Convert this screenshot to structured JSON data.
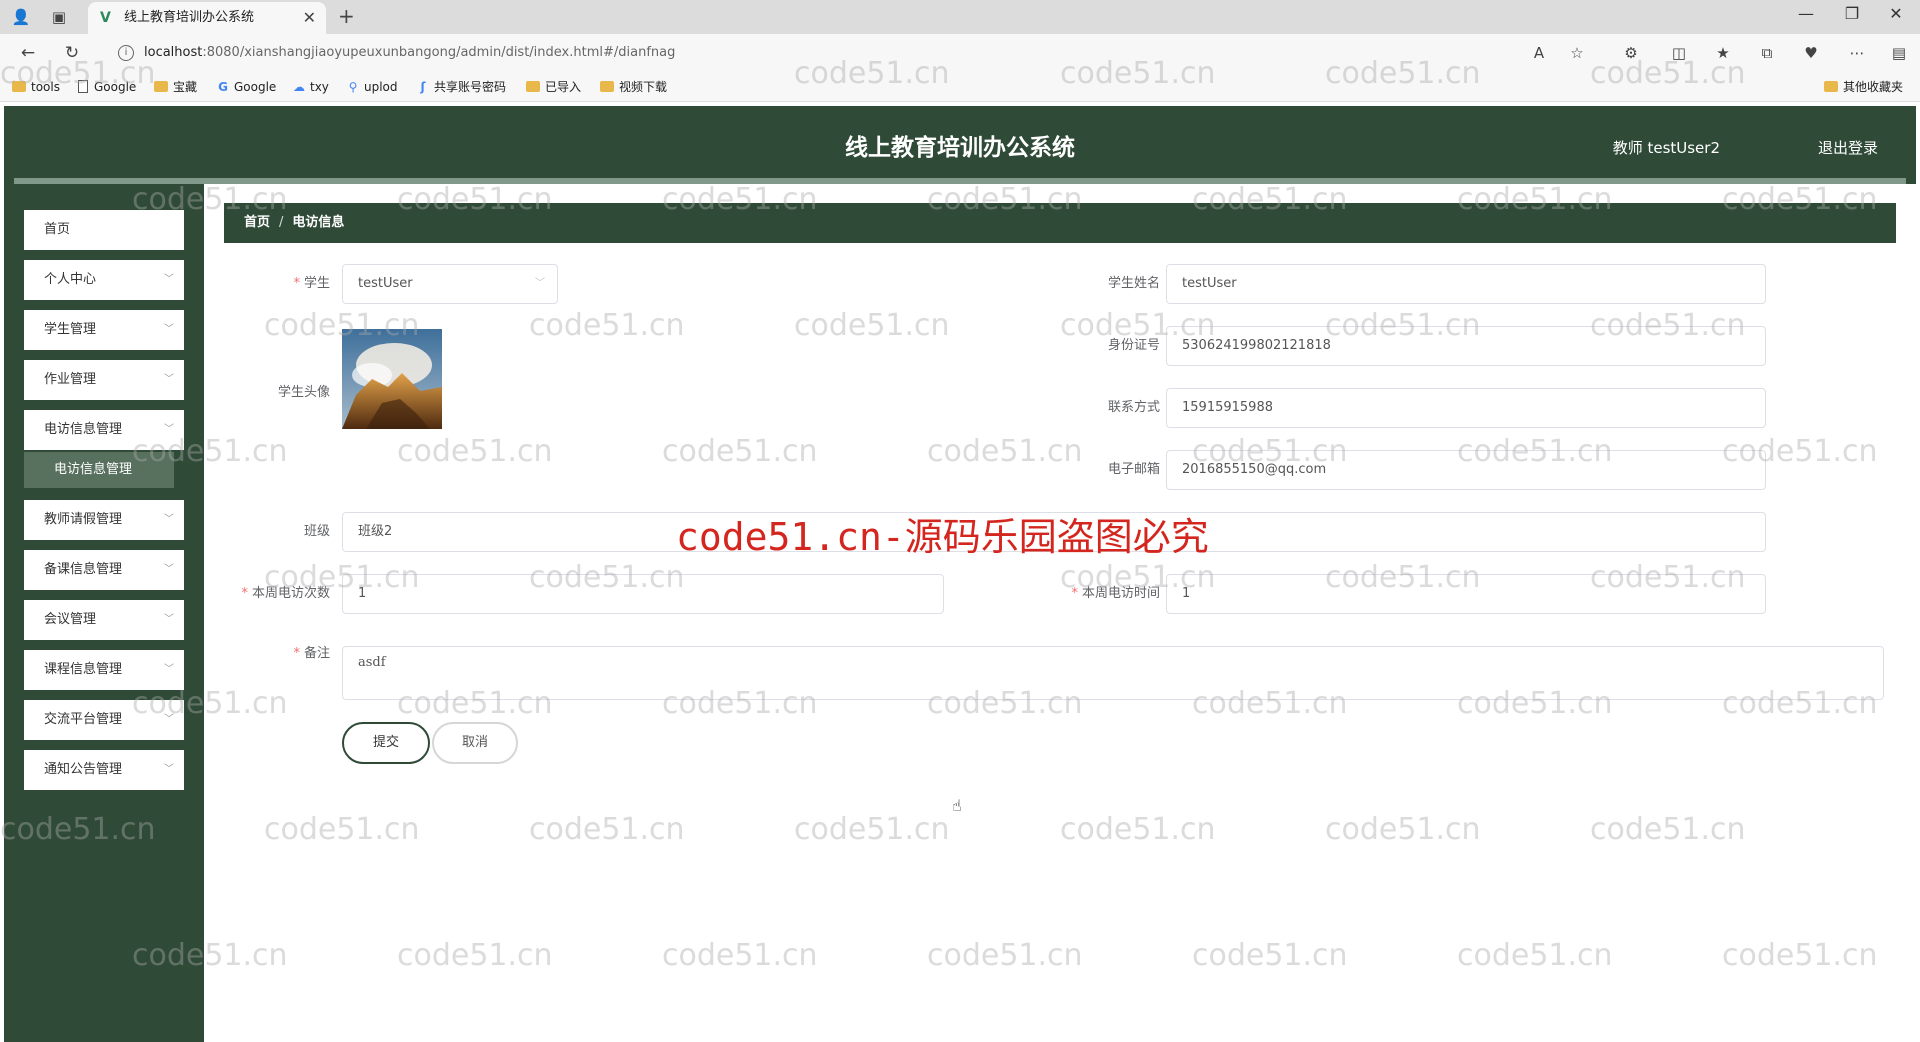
{
  "browser": {
    "tab_title": "线上教育培训办公系统",
    "url_host": "localhost",
    "url_path": ":8080/xianshangjiaoyupeuxunbangong/admin/dist/index.html#/dianfnag",
    "bookmarks": [
      "tools",
      "Google",
      "宝藏",
      "Google",
      "txy",
      "uplod",
      "共享账号密码",
      "已导入",
      "视频下载"
    ],
    "other_bookmarks": "其他收藏夹"
  },
  "header": {
    "title": "线上教育培训办公系统",
    "user": "教师 testUser2",
    "logout": "退出登录"
  },
  "sidebar": {
    "items": [
      {
        "label": "首页"
      },
      {
        "label": "个人中心"
      },
      {
        "label": "学生管理"
      },
      {
        "label": "作业管理"
      },
      {
        "label": "电访信息管理"
      },
      {
        "label": "教师请假管理"
      },
      {
        "label": "备课信息管理"
      },
      {
        "label": "会议管理"
      },
      {
        "label": "课程信息管理"
      },
      {
        "label": "交流平台管理"
      },
      {
        "label": "通知公告管理"
      }
    ],
    "active_sub": "电访信息管理"
  },
  "breadcrumb": {
    "home": "首页",
    "separator": "/",
    "current": "电访信息"
  },
  "form": {
    "student_label": "学生",
    "student_value": "testUser",
    "student_name_label": "学生姓名",
    "student_name_value": "testUser",
    "id_label": "身份证号",
    "id_value": "530624199802121818",
    "avatar_label": "学生头像",
    "phone_label": "联系方式",
    "phone_value": "15915915988",
    "email_label": "电子邮箱",
    "email_value": "2016855150@qq.com",
    "class_label": "班级",
    "class_value": "班级2",
    "visits_label": "本周电访次数",
    "visits_value": "1",
    "visit_time_label": "本周电访时间",
    "visit_time_value": "1",
    "remark_label": "备注",
    "remark_value": "asdf",
    "submit": "提交",
    "cancel": "取消"
  },
  "watermark": {
    "text": "code51.cn",
    "banner": "code51.cn-源码乐园盗图必究"
  }
}
